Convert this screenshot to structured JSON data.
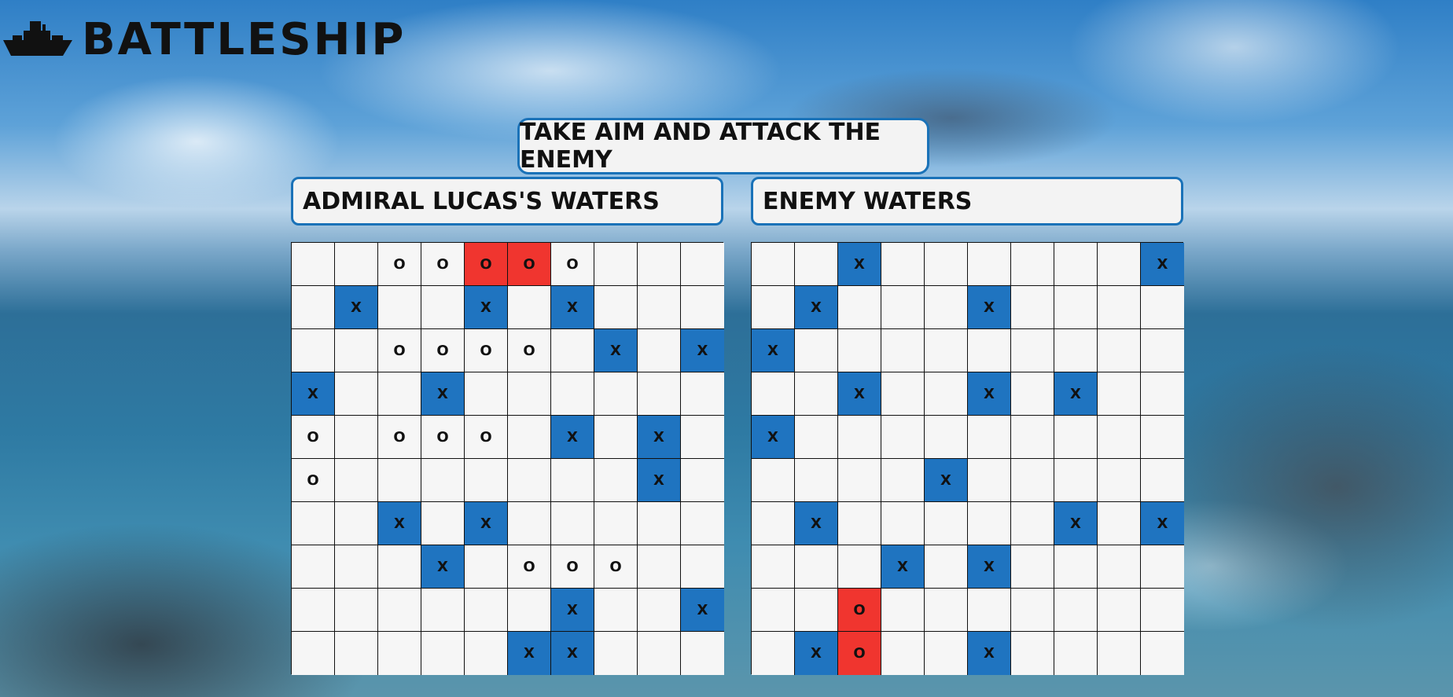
{
  "app": {
    "title": "BATTLESHIP",
    "logo_icon": "battleship-icon"
  },
  "banner": {
    "text": "TAKE AIM AND ATTACK THE ENEMY"
  },
  "colors": {
    "miss": "#1f74c0",
    "hit": "#f0352f",
    "cell": "#f6f6f6",
    "panel_border": "#1a72b8"
  },
  "legend_note": "cell states: '' empty, 'X' miss (blue), 'O' ship/hit-able, 'O!' hit (red)",
  "player_board": {
    "title": "ADMIRAL LUCAS'S WATERS",
    "rows": [
      [
        "",
        "",
        "O",
        "O",
        "O!",
        "O!",
        "O",
        "",
        "",
        ""
      ],
      [
        "",
        "X",
        "",
        "",
        "X",
        "",
        "X",
        "",
        "",
        ""
      ],
      [
        "",
        "",
        "O",
        "O",
        "O",
        "O",
        "",
        "X",
        "",
        "X"
      ],
      [
        "X",
        "",
        "",
        "X",
        "",
        "",
        "",
        "",
        "",
        ""
      ],
      [
        "O",
        "",
        "O",
        "O",
        "O",
        "",
        "X",
        "",
        "X",
        ""
      ],
      [
        "O",
        "",
        "",
        "",
        "",
        "",
        "",
        "",
        "X",
        ""
      ],
      [
        "",
        "",
        "X",
        "",
        "X",
        "",
        "",
        "",
        "",
        ""
      ],
      [
        "",
        "",
        "",
        "X",
        "",
        "O",
        "O",
        "O",
        "",
        ""
      ],
      [
        "",
        "",
        "",
        "",
        "",
        "",
        "X",
        "",
        "",
        "X"
      ],
      [
        "",
        "",
        "",
        "",
        "",
        "X",
        "X",
        "",
        "",
        ""
      ]
    ]
  },
  "enemy_board": {
    "title": "ENEMY WATERS",
    "rows": [
      [
        "",
        "",
        "X",
        "",
        "",
        "",
        "",
        "",
        "",
        "X"
      ],
      [
        "",
        "X",
        "",
        "",
        "",
        "X",
        "",
        "",
        "",
        ""
      ],
      [
        "X",
        "",
        "",
        "",
        "",
        "",
        "",
        "",
        "",
        ""
      ],
      [
        "",
        "",
        "X",
        "",
        "",
        "X",
        "",
        "X",
        "",
        ""
      ],
      [
        "X",
        "",
        "",
        "",
        "",
        "",
        "",
        "",
        "",
        ""
      ],
      [
        "",
        "",
        "",
        "",
        "X",
        "",
        "",
        "",
        "",
        ""
      ],
      [
        "",
        "X",
        "",
        "",
        "",
        "",
        "",
        "X",
        "",
        "X"
      ],
      [
        "",
        "",
        "",
        "X",
        "",
        "X",
        "",
        "",
        "",
        ""
      ],
      [
        "",
        "",
        "O!",
        "",
        "",
        "",
        "",
        "",
        "",
        ""
      ],
      [
        "",
        "X",
        "O!",
        "",
        "",
        "X",
        "",
        "",
        "",
        ""
      ]
    ]
  }
}
